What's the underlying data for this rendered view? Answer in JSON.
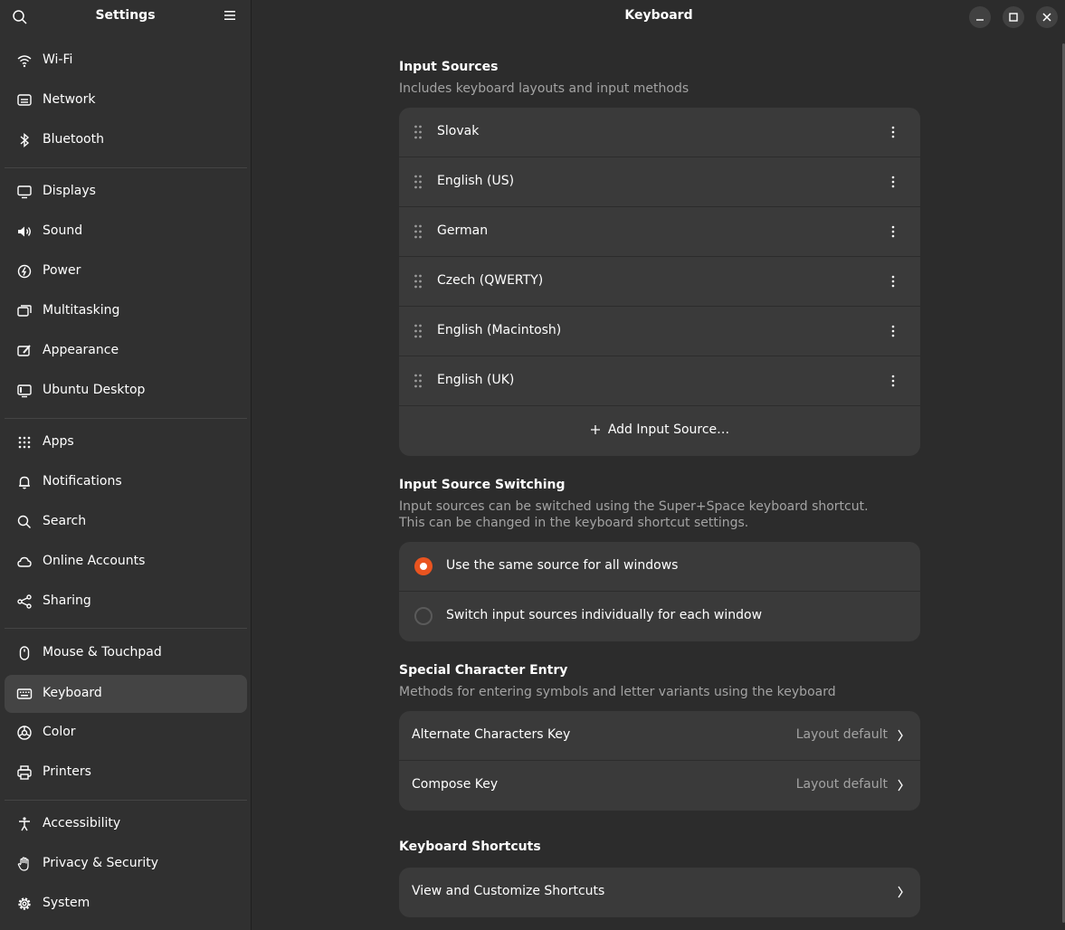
{
  "sidebar": {
    "title": "Settings",
    "items": [
      {
        "label": "Wi-Fi",
        "icon": "wifi-icon"
      },
      {
        "label": "Network",
        "icon": "network-icon"
      },
      {
        "label": "Bluetooth",
        "icon": "bluetooth-icon"
      },
      {
        "label": "Displays",
        "icon": "display-icon"
      },
      {
        "label": "Sound",
        "icon": "speaker-icon"
      },
      {
        "label": "Power",
        "icon": "power-icon"
      },
      {
        "label": "Multitasking",
        "icon": "multitasking-icon"
      },
      {
        "label": "Appearance",
        "icon": "appearance-icon"
      },
      {
        "label": "Ubuntu Desktop",
        "icon": "ubuntu-desktop-icon"
      },
      {
        "label": "Apps",
        "icon": "apps-grid-icon"
      },
      {
        "label": "Notifications",
        "icon": "bell-icon"
      },
      {
        "label": "Search",
        "icon": "search-icon"
      },
      {
        "label": "Online Accounts",
        "icon": "cloud-icon"
      },
      {
        "label": "Sharing",
        "icon": "share-icon"
      },
      {
        "label": "Mouse & Touchpad",
        "icon": "mouse-icon"
      },
      {
        "label": "Keyboard",
        "icon": "keyboard-icon"
      },
      {
        "label": "Color",
        "icon": "color-icon"
      },
      {
        "label": "Printers",
        "icon": "printer-icon"
      },
      {
        "label": "Accessibility",
        "icon": "accessibility-icon"
      },
      {
        "label": "Privacy & Security",
        "icon": "hand-icon"
      },
      {
        "label": "System",
        "icon": "gear-icon"
      }
    ],
    "active": "Keyboard"
  },
  "main": {
    "title": "Keyboard",
    "input_sources": {
      "title": "Input Sources",
      "subtitle": "Includes keyboard layouts and input methods",
      "items": [
        "Slovak",
        "English (US)",
        "German",
        "Czech (QWERTY)",
        "English (Macintosh)",
        "English (UK)"
      ],
      "add_label": "Add Input Source…"
    },
    "switching": {
      "title": "Input Source Switching",
      "subtitle_line1": "Input sources can be switched using the Super+Space keyboard shortcut.",
      "subtitle_line2": "This can be changed in the keyboard shortcut settings.",
      "options": [
        "Use the same source for all windows",
        "Switch input sources individually for each window"
      ],
      "selected": 0
    },
    "special": {
      "title": "Special Character Entry",
      "subtitle": "Methods for entering symbols and letter variants using the keyboard",
      "rows": [
        {
          "label": "Alternate Characters Key",
          "value": "Layout default"
        },
        {
          "label": "Compose Key",
          "value": "Layout default"
        }
      ]
    },
    "shortcuts": {
      "title": "Keyboard Shortcuts",
      "row_label": "View and Customize Shortcuts"
    }
  },
  "colors": {
    "accent": "#e95420",
    "sidebar_bg": "#303030",
    "main_bg": "#2c2c2c",
    "card_bg": "#3a3a3a"
  }
}
